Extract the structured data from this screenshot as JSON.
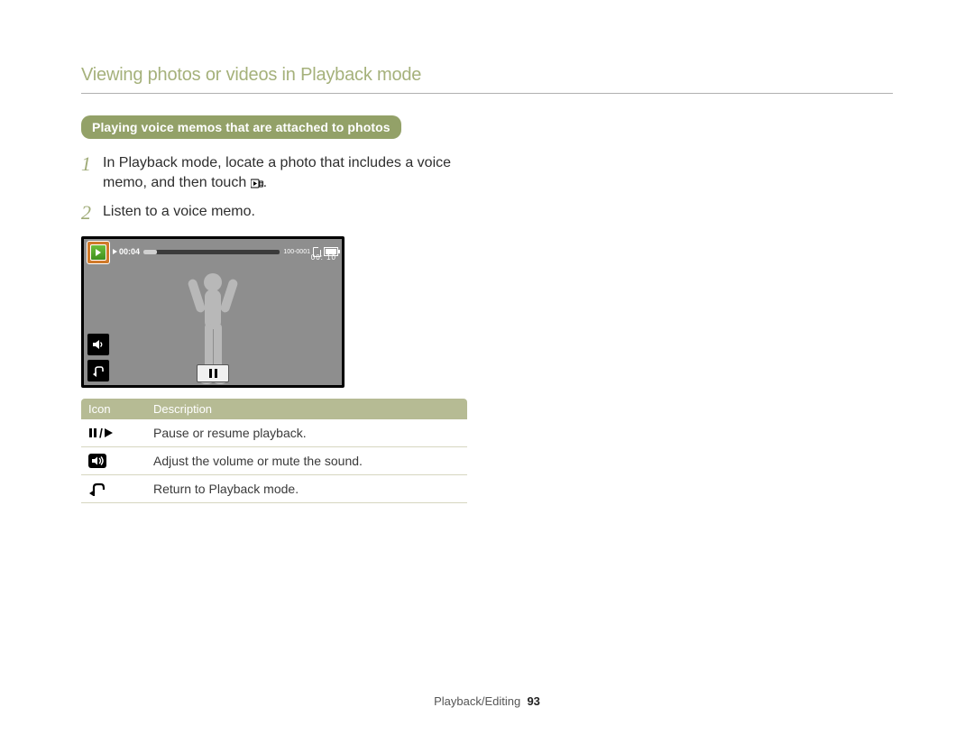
{
  "page_title": "Viewing photos or videos in Playback mode",
  "section_pill": "Playing voice memos that are attached to photos",
  "steps": [
    {
      "num": "1",
      "text_before": "In Playback mode, locate a photo that includes a voice memo, and then touch ",
      "icon": "memo-play-icon",
      "text_after": "."
    },
    {
      "num": "2",
      "text_before": "Listen to a voice memo.",
      "icon": null,
      "text_after": ""
    }
  ],
  "screenshot": {
    "elapsed": "00:04",
    "file_label": "100-0001",
    "total": "00: 10"
  },
  "table": {
    "headers": {
      "icon": "Icon",
      "desc": "Description"
    },
    "rows": [
      {
        "icon": "pause-play-icon",
        "desc": "Pause or resume playback."
      },
      {
        "icon": "volume-icon",
        "desc": "Adjust the volume or mute the sound."
      },
      {
        "icon": "return-icon",
        "desc": "Return to Playback mode."
      }
    ]
  },
  "footer": {
    "section": "Playback/Editing",
    "page": "93"
  }
}
